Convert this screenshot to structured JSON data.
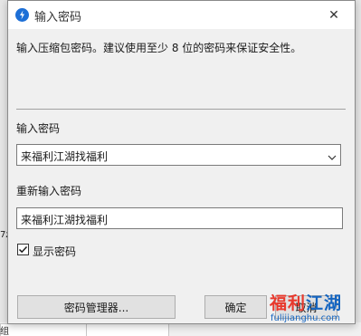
{
  "window": {
    "title": "输入密码",
    "close_glyph": "✕"
  },
  "description": "输入压缩包密码。建议使用至少 8 位的密码来保证安全性。",
  "password": {
    "label": "输入密码",
    "value": "来福利江湖找福利"
  },
  "confirm_password": {
    "label": "重新输入密码",
    "value": "来福利江湖找福利"
  },
  "show_password": {
    "label": "显示密码",
    "checked": true
  },
  "buttons": {
    "manager": "密码管理器...",
    "ok": "确定",
    "cancel": "取消"
  },
  "background_fragments": {
    "left_text_1": "7z",
    "left_text_2": "组"
  },
  "watermark": {
    "text_red": "福利",
    "text_blue": "江湖",
    "url": "fulijianghu.com"
  },
  "colors": {
    "accent": "#1d6fd6",
    "watermark_red": "#e8392d",
    "watermark_blue": "#1565c0"
  }
}
